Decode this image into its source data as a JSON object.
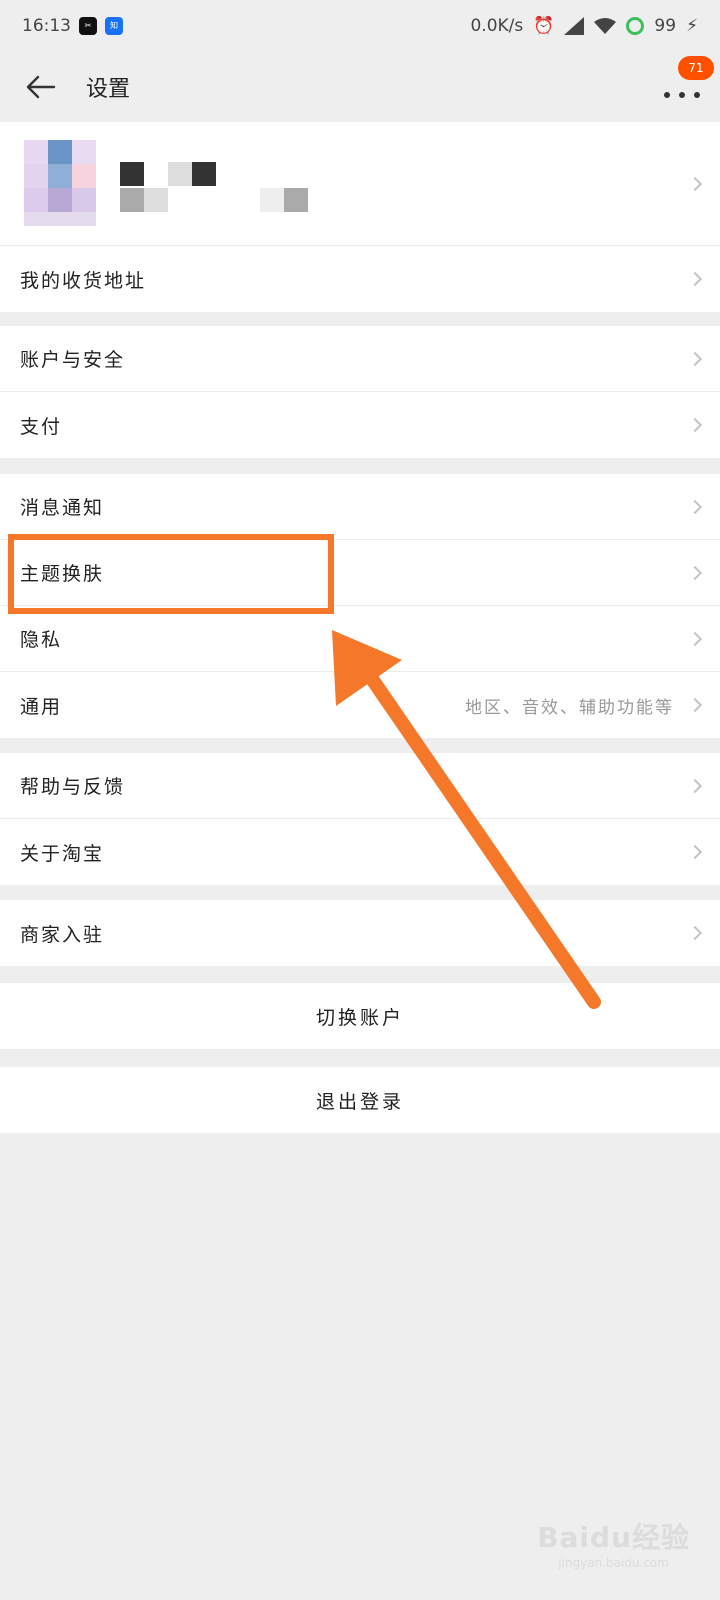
{
  "status_bar": {
    "time": "16:13",
    "network_speed": "0.0K/s",
    "battery": "99",
    "icons": [
      "capcut-icon",
      "zhihu-icon",
      "alarm-icon",
      "hd-signal-icon",
      "wifi-icon",
      "ring-icon",
      "charging-icon"
    ]
  },
  "app_bar": {
    "title": "设置",
    "notification_count": "71"
  },
  "profile": {
    "address_label": "我的收货地址"
  },
  "groups": {
    "account": [
      "账户与安全",
      "支付"
    ],
    "preferences": {
      "notifications": "消息通知",
      "theme": "主题换肤",
      "privacy": "隐私",
      "general": "通用",
      "general_sub": "地区、音效、辅助功能等"
    },
    "support": [
      "帮助与反馈",
      "关于淘宝"
    ],
    "merchant": "商家入驻"
  },
  "actions": {
    "switch_account": "切换账户",
    "logout": "退出登录"
  },
  "watermark": {
    "brand": "Baidu经验",
    "domain": "jingyan.baidu.com"
  },
  "colors": {
    "accent": "#ff5000",
    "annotation": "#f5782a",
    "background": "#eeeeee"
  }
}
